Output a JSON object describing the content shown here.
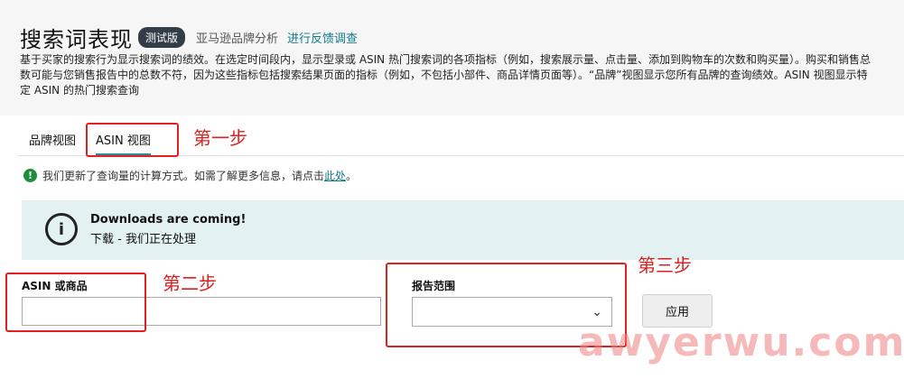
{
  "header": {
    "title": "搜索词表现",
    "beta_badge": "测试版",
    "brand_analytics": "亚马逊品牌分析",
    "survey_link": "进行反馈调查",
    "description": "基于买家的搜索行为显示搜索词的绩效。在选定时间段内，显示型录或 ASIN 热门搜索词的各项指标（例如，搜索展示量、点击量、添加到购物车的次数和购买量）。购买和销售总数可能与您销售报告中的总数不符，因为这些指标包括搜索结果页面的指标（例如，不包括小部件、商品详情页面等）。“品牌”视图显示您所有品牌的查询绩效。ASIN 视图显示特定 ASIN 的热门搜索查询"
  },
  "tabs": [
    {
      "label": "品牌视图",
      "active": false
    },
    {
      "label": "ASIN 视图",
      "active": true
    }
  ],
  "notice": {
    "text": "我们更新了查询量的计算方式。如需了解更多信息，请点击",
    "link": "此处",
    "suffix": "。"
  },
  "banner": {
    "title": "Downloads are coming!",
    "subtitle": "下载 - 我们正在处理"
  },
  "form": {
    "asin_label": "ASIN 或商品",
    "asin_value": "",
    "range_label": "报告范围",
    "range_value": "",
    "apply_label": "应用"
  },
  "annotations": {
    "step1": "第一步",
    "step2": "第二步",
    "step3": "第三步",
    "watermark": "awyerwu.com"
  },
  "colors": {
    "accent": "#117a8b",
    "banner_bg": "#e4f1f3",
    "annotation_red": "#e02020",
    "success_green": "#1e8e3e"
  }
}
